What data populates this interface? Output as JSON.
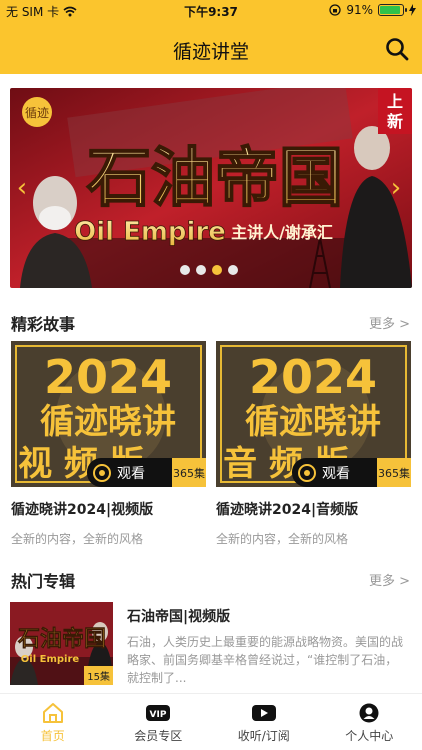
{
  "status_bar": {
    "carrier": "无 SIM 卡",
    "time": "下午9:37",
    "battery_percent": "91%",
    "battery_level": 0.91
  },
  "nav": {
    "title": "循迹讲堂"
  },
  "banner": {
    "title_cn": "石油帝国",
    "title_en": "Oil Empire",
    "presenter": "主讲人/谢承汇",
    "badge_line1": "上",
    "badge_line2": "新",
    "logo": "循迹",
    "slide_count": 4,
    "active_slide": 3
  },
  "section_stories": {
    "title": "精彩故事",
    "more": "更多 >",
    "cards": [
      {
        "cover_year": "2024",
        "cover_line1": "循迹晓讲",
        "cover_line2": "视 频 版",
        "watch_label": "观看",
        "count": "365集",
        "title": "循迹晓讲2024|视频版",
        "subtitle": "全新的内容，全新的风格"
      },
      {
        "cover_year": "2024",
        "cover_line1": "循迹晓讲",
        "cover_line2": "音 频 版",
        "watch_label": "观看",
        "count": "365集",
        "title": "循迹晓讲2024|音频版",
        "subtitle": "全新的内容，全新的风格"
      }
    ]
  },
  "section_albums": {
    "title": "热门专辑",
    "more": "更多 >",
    "items": [
      {
        "cover_cn": "石油帝国",
        "cover_en": "Oil Empire",
        "count": "15集",
        "title": "石油帝国|视频版",
        "description": "石油，人类历史上最重要的能源战略物资。美国的战略家、前国务卿基辛格曾经说过，“谁控制了石油，就控制了..."
      }
    ]
  },
  "tabbar": {
    "items": [
      {
        "label": "首页",
        "icon": "home-icon",
        "active": true
      },
      {
        "label": "会员专区",
        "icon": "vip-icon",
        "active": false
      },
      {
        "label": "收听/订阅",
        "icon": "play-icon",
        "active": false
      },
      {
        "label": "个人中心",
        "icon": "user-icon",
        "active": false
      }
    ]
  },
  "colors": {
    "accent": "#fbc52d",
    "banner_red": "#b3121c",
    "muted_text": "#999999"
  }
}
